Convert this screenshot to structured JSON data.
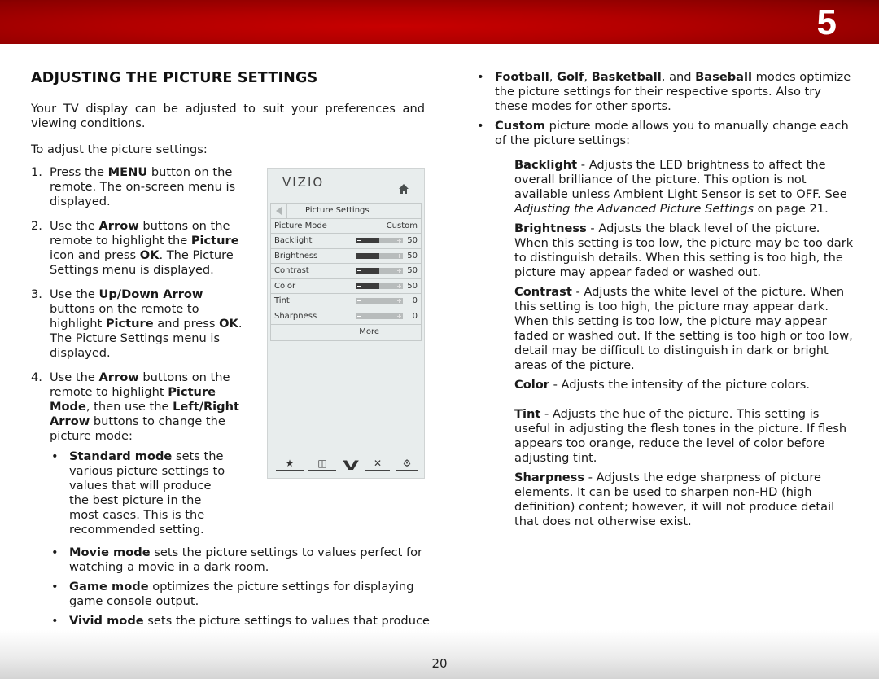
{
  "header": {
    "chapter_number": "5",
    "bar_color": "#c00000"
  },
  "section": {
    "title": "ADJUSTING THE PICTURE SETTINGS",
    "intro": "Your TV display can be adjusted to suit your preferences and viewing conditions.",
    "intro2": "To adjust the picture settings:"
  },
  "steps": [
    {
      "num": "1.",
      "parts": [
        {
          "t": "Press the "
        },
        {
          "b": "MENU"
        },
        {
          "t": " button on the remote. The on-screen menu is displayed."
        }
      ]
    },
    {
      "num": "2.",
      "parts": [
        {
          "t": "Use the "
        },
        {
          "b": "Arrow"
        },
        {
          "t": " buttons on the remote to highlight the "
        },
        {
          "b": "Picture"
        },
        {
          "t": " icon and press "
        },
        {
          "b": "OK"
        },
        {
          "t": ". The Picture Settings menu is displayed."
        }
      ]
    },
    {
      "num": "3.",
      "parts": [
        {
          "t": "Use the "
        },
        {
          "b": "Up/Down Arrow"
        },
        {
          "t": " buttons on the remote to highlight "
        },
        {
          "b": "Picture"
        },
        {
          "t": " and press "
        },
        {
          "b": "OK"
        },
        {
          "t": ". The Picture Settings menu is displayed."
        }
      ]
    },
    {
      "num": "4.",
      "parts": [
        {
          "t": "Use the "
        },
        {
          "b": "Arrow"
        },
        {
          "t": " buttons on the remote to highlight "
        },
        {
          "b": "Picture Mode"
        },
        {
          "t": ", then use the "
        },
        {
          "b": "Left/Right Arrow"
        },
        {
          "t": " buttons to change the picture mode:"
        }
      ]
    }
  ],
  "modes": [
    {
      "name": "Standard mode",
      "text": " sets the various picture settings to values that will produce the best picture in the most cases. This is the recommended setting."
    },
    {
      "name": "Movie mode",
      "text": " sets the picture settings to values perfect for watching a movie in a dark room."
    },
    {
      "name": "Game mode",
      "text": " optimizes the picture settings for displaying game console output."
    },
    {
      "name": "Vivid mode",
      "text": " sets the picture settings to values that produce a brighter, more vivid picture."
    }
  ],
  "right_bullets": [
    {
      "parts": [
        {
          "b": "Football"
        },
        {
          "t": ", "
        },
        {
          "b": "Golf"
        },
        {
          "t": ", "
        },
        {
          "b": "Basketball"
        },
        {
          "t": ", and "
        },
        {
          "b": "Baseball"
        },
        {
          "t": " modes optimize the picture settings for their respective sports. Also try these modes for other sports."
        }
      ]
    },
    {
      "parts": [
        {
          "b": "Custom"
        },
        {
          "t": " picture mode allows you to manually change each of the picture settings:"
        }
      ]
    }
  ],
  "definitions": [
    {
      "term": "Backlight",
      "parts": [
        {
          "t": " - Adjusts the LED brightness to affect the overall brilliance of the picture. This option is not available unless Ambient Light Sensor is set to OFF. See "
        },
        {
          "i": "Adjusting the Advanced Picture Settings"
        },
        {
          "t": " on page 21."
        }
      ]
    },
    {
      "term": "Brightness",
      "parts": [
        {
          "t": " - Adjusts the black level of the picture. When this setting is too low, the picture may be too dark to distinguish details. When this setting is too high, the picture may appear faded or washed out."
        }
      ]
    },
    {
      "term": "Contrast",
      "parts": [
        {
          "t": " - Adjusts the white level of the picture. When this setting is too high, the picture may appear dark. When this setting is too low, the picture may appear faded or washed out. If the setting is too high or too low, detail may be difficult to distinguish in dark or bright areas of the picture."
        }
      ]
    },
    {
      "term": "Color",
      "parts": [
        {
          "t": " - Adjusts the intensity of the picture colors."
        }
      ]
    },
    {
      "term": "Tint",
      "parts": [
        {
          "t": " - Adjusts the hue of the picture. This setting is useful in adjusting the flesh tones in the picture. If flesh appears too orange, reduce the level of color before adjusting tint."
        }
      ]
    },
    {
      "term": "Sharpness",
      "parts": [
        {
          "t": " - Adjusts the edge sharpness of picture elements. It can be used to sharpen non-HD (high definition) content; however, it will not produce detail that does not otherwise exist."
        }
      ]
    }
  ],
  "tv_menu": {
    "logo": "VIZIO",
    "home_icon": "home-icon",
    "back_icon": "back-arrow-icon",
    "title": "Picture Settings",
    "picture_mode": {
      "label": "Picture Mode",
      "value": "Custom"
    },
    "sliders": [
      {
        "label": "Backlight",
        "value": "50",
        "fraction": 0.5
      },
      {
        "label": "Brightness",
        "value": "50",
        "fraction": 0.5
      },
      {
        "label": "Contrast",
        "value": "50",
        "fraction": 0.5
      },
      {
        "label": "Color",
        "value": "50",
        "fraction": 0.5
      },
      {
        "label": "Tint",
        "value": "0",
        "fraction": 0
      },
      {
        "label": "Sharpness",
        "value": "0",
        "fraction": 0
      }
    ],
    "more_label": "More",
    "toolbar_icons": [
      {
        "name": "star-icon",
        "glyph": "★"
      },
      {
        "name": "wide-icon",
        "glyph": "◫"
      },
      {
        "name": "vizio-v-icon",
        "glyph": "V"
      },
      {
        "name": "close-icon",
        "glyph": "✕"
      },
      {
        "name": "settings-gear-icon",
        "glyph": "⚙"
      }
    ]
  },
  "footer": {
    "page_number": "20"
  }
}
